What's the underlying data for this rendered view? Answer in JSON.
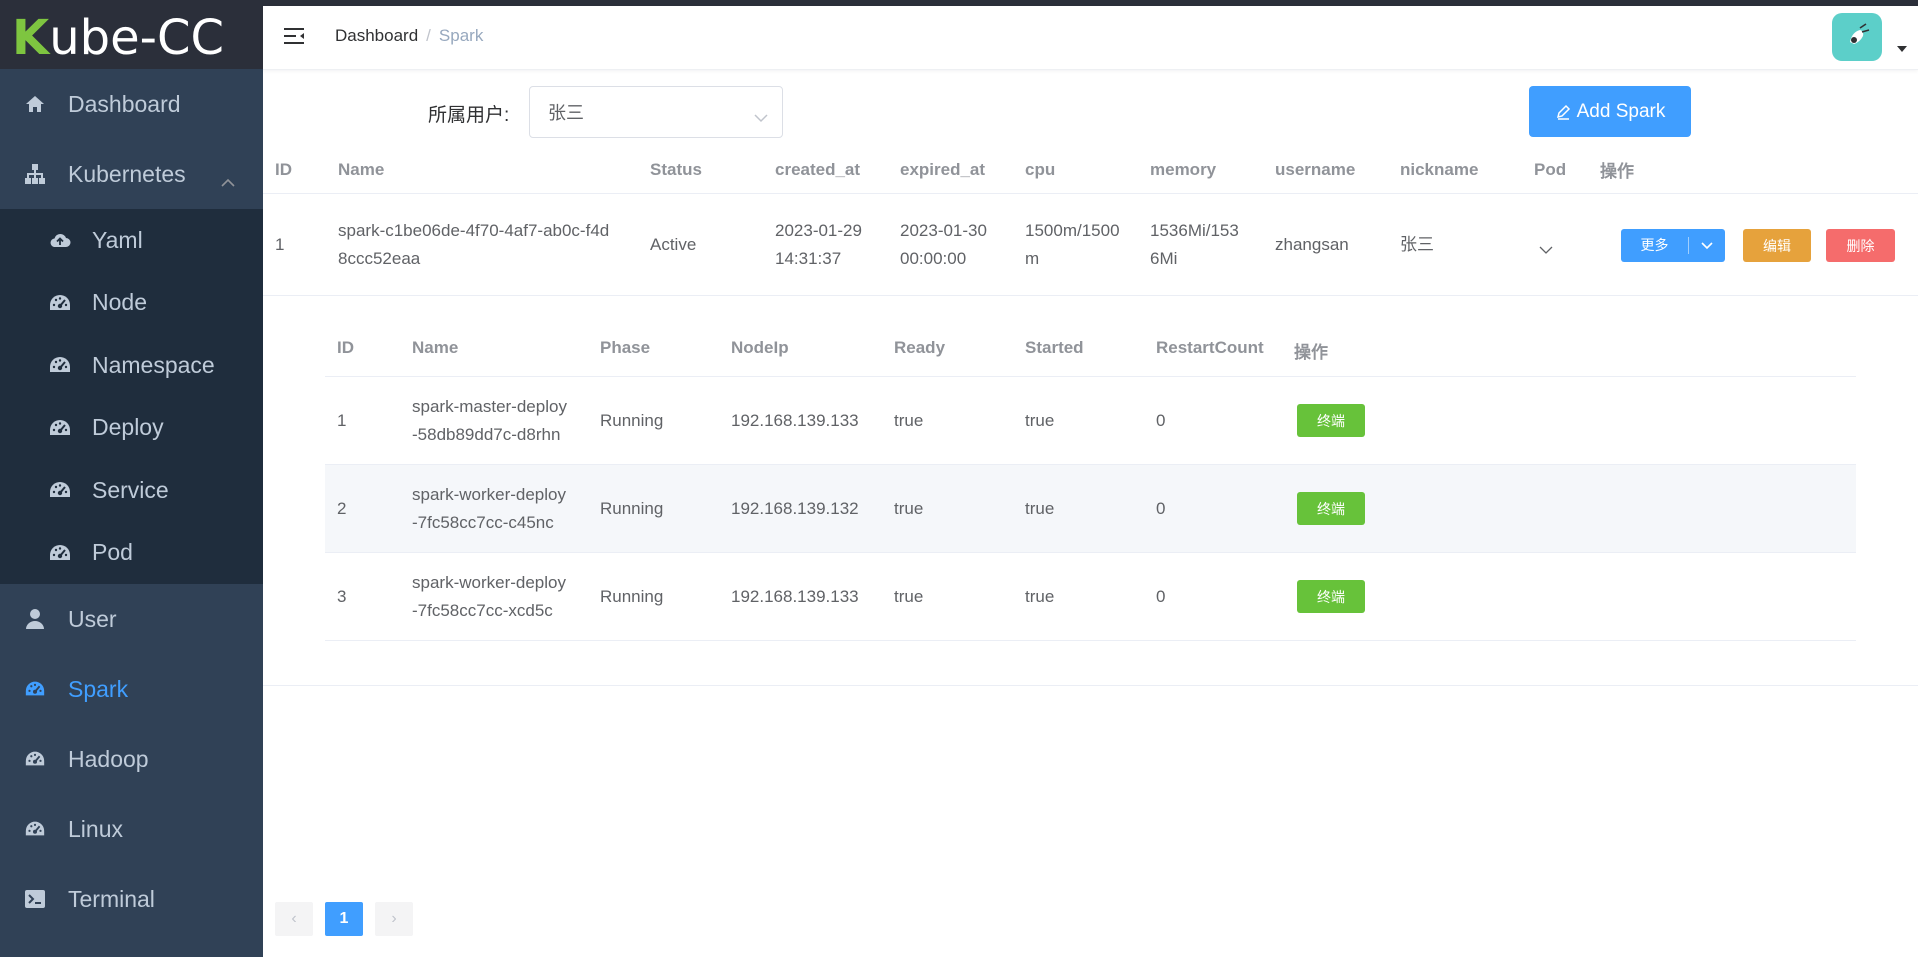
{
  "app": {
    "logo_k": "K",
    "logo_rest": "ube-CC"
  },
  "colors": {
    "sidebar_bg": "#304156",
    "accent": "#409eff",
    "success": "#67c23a",
    "warning": "#e6a23c",
    "danger": "#f56c6c"
  },
  "sidebar": {
    "items": [
      {
        "label": "Dashboard",
        "icon": "home-icon"
      },
      {
        "label": "Kubernetes",
        "icon": "sitemap-icon",
        "expanded": true
      },
      {
        "label": "User",
        "icon": "user-icon"
      },
      {
        "label": "Spark",
        "icon": "dashboard-gauge-icon",
        "active": true
      },
      {
        "label": "Hadoop",
        "icon": "dashboard-gauge-icon"
      },
      {
        "label": "Linux",
        "icon": "dashboard-gauge-icon"
      },
      {
        "label": "Terminal",
        "icon": "terminal-icon"
      }
    ],
    "kubernetes_children": [
      {
        "label": "Yaml",
        "icon": "cloud-upload-icon"
      },
      {
        "label": "Node",
        "icon": "dashboard-gauge-icon"
      },
      {
        "label": "Namespace",
        "icon": "dashboard-gauge-icon"
      },
      {
        "label": "Deploy",
        "icon": "dashboard-gauge-icon"
      },
      {
        "label": "Service",
        "icon": "dashboard-gauge-icon"
      },
      {
        "label": "Pod",
        "icon": "dashboard-gauge-icon"
      }
    ]
  },
  "breadcrumb": {
    "home": "Dashboard",
    "separator": "/",
    "current": "Spark"
  },
  "filter": {
    "label": "所属用户:",
    "selected": "张三"
  },
  "toolbar": {
    "add_label": "Add Spark"
  },
  "table": {
    "headers": [
      "ID",
      "Name",
      "Status",
      "created_at",
      "expired_at",
      "cpu",
      "memory",
      "username",
      "nickname",
      "Pod",
      "操作"
    ],
    "rows": [
      {
        "id": "1",
        "name_line1": "spark-c1be06de-4f70-4af7-ab0c-f4d",
        "name_line2": "8ccc52eaa",
        "status": "Active",
        "created_line1": "2023-01-29",
        "created_line2": "14:31:37",
        "expired_line1": "2023-01-30",
        "expired_line2": "00:00:00",
        "cpu_line1": "1500m/1500",
        "cpu_line2": "m",
        "memory_line1": "1536Mi/153",
        "memory_line2": "6Mi",
        "username": "zhangsan",
        "nickname": "张三",
        "more_label": "更多",
        "edit_label": "编辑",
        "delete_label": "删除"
      }
    ]
  },
  "pods": {
    "headers": [
      "ID",
      "Name",
      "Phase",
      "NodeIp",
      "Ready",
      "Started",
      "RestartCount",
      "操作"
    ],
    "rows": [
      {
        "id": "1",
        "name_line1": "spark-master-deploy",
        "name_line2": "-58db89dd7c-d8rhn",
        "phase": "Running",
        "node_ip": "192.168.139.133",
        "ready": "true",
        "started": "true",
        "restart_count": "0",
        "action": "终端"
      },
      {
        "id": "2",
        "name_line1": "spark-worker-deploy",
        "name_line2": "-7fc58cc7cc-c45nc",
        "phase": "Running",
        "node_ip": "192.168.139.132",
        "ready": "true",
        "started": "true",
        "restart_count": "0",
        "action": "终端"
      },
      {
        "id": "3",
        "name_line1": "spark-worker-deploy",
        "name_line2": "-7fc58cc7cc-xcd5c",
        "phase": "Running",
        "node_ip": "192.168.139.133",
        "ready": "true",
        "started": "true",
        "restart_count": "0",
        "action": "终端"
      }
    ]
  },
  "pagination": {
    "prev": "‹",
    "current": "1",
    "next": "›"
  }
}
